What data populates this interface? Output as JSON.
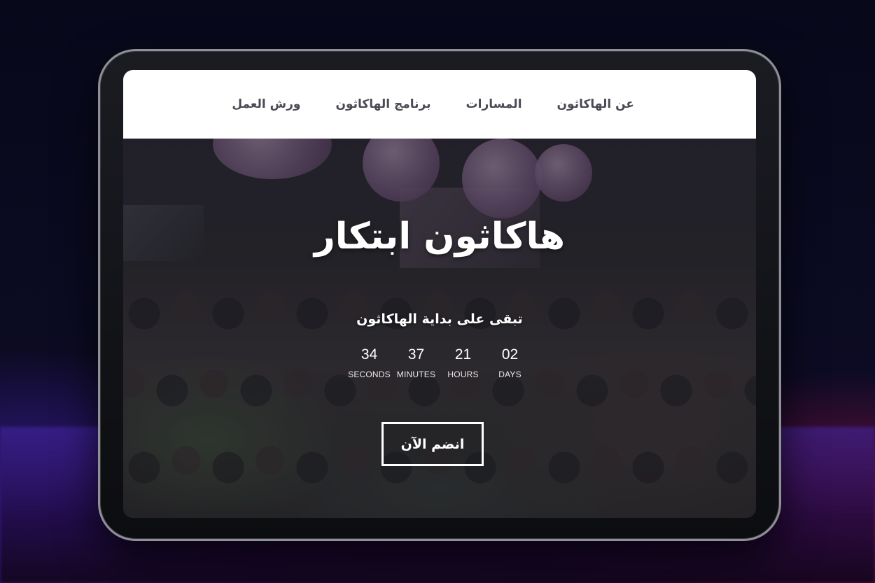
{
  "nav": {
    "items": [
      {
        "label": "عن الهاكاثون"
      },
      {
        "label": "المسارات"
      },
      {
        "label": "برنامج الهاكاثون"
      },
      {
        "label": "ورش العمل"
      }
    ]
  },
  "hero": {
    "title": "هاكاثون ابتكار",
    "subtitle": "تبقى على بداية الهاكاثون",
    "countdown": [
      {
        "value": "34",
        "label": "SECONDS"
      },
      {
        "value": "37",
        "label": "MINUTES"
      },
      {
        "value": "21",
        "label": "HOURS"
      },
      {
        "value": "02",
        "label": "DAYS"
      }
    ],
    "join_label": "انضم الآن"
  },
  "colors": {
    "nav_background": "#ffffff",
    "nav_text": "#4a4a55",
    "hero_text": "#ffffff"
  }
}
